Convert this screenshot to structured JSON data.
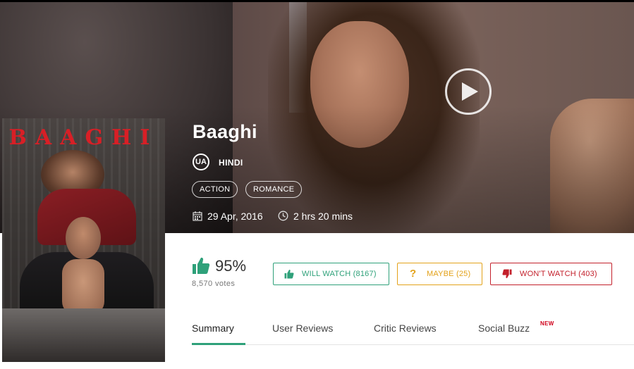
{
  "movie": {
    "title": "Baaghi",
    "certificate": "UA",
    "language": "HINDI",
    "genres": [
      "ACTION",
      "ROMANCE"
    ],
    "release_date": "29 Apr, 2016",
    "duration": "2 hrs 20 mins",
    "poster_title": "BAAGHI"
  },
  "rating": {
    "percent": "95%",
    "votes": "8,570 votes"
  },
  "actions": {
    "will_watch": "WILL WATCH (8167)",
    "maybe": "MAYBE (25)",
    "maybe_icon": "?",
    "wont_watch": "WON'T WATCH (403)"
  },
  "tabs": [
    {
      "label": "Summary",
      "active": true
    },
    {
      "label": "User Reviews"
    },
    {
      "label": "Critic Reviews"
    },
    {
      "label": "Social Buzz",
      "badge": "NEW"
    }
  ],
  "colors": {
    "accent_green": "#2fa17a",
    "maybe_orange": "#e3a21a",
    "wont_red": "#c3202b",
    "poster_title_red": "#d81f26"
  },
  "icons": [
    "play-icon",
    "calendar-icon",
    "clock-icon",
    "thumbs-up-icon",
    "thumbs-down-icon"
  ]
}
